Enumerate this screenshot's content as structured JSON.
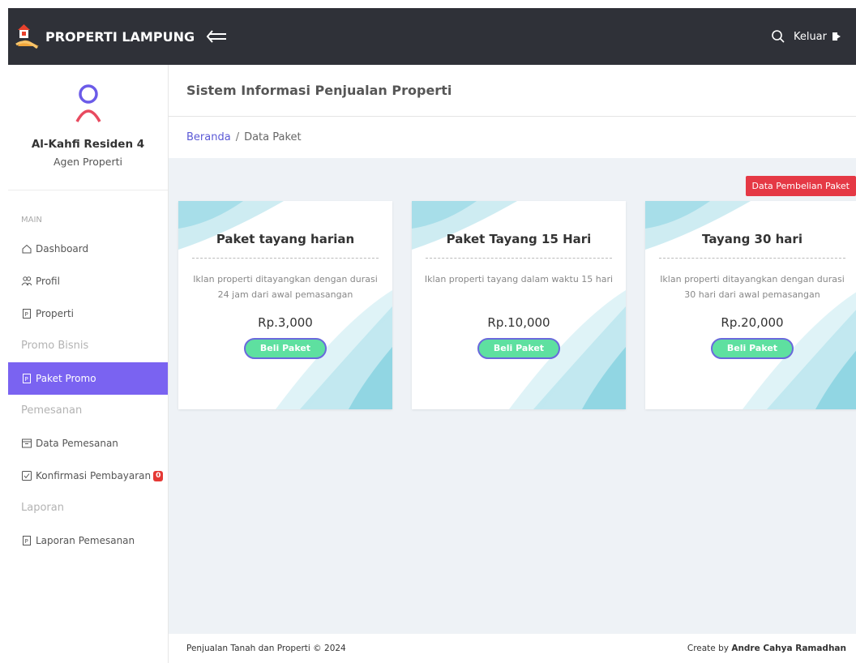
{
  "app": {
    "brand": "PROPERTI LAMPUNG",
    "logout_label": "Keluar"
  },
  "sidebar": {
    "profile_name": "Al-Kahfi Residen 4",
    "profile_role": "Agen Properti",
    "section_main": "MAIN",
    "items": [
      {
        "label": "Dashboard",
        "icon": "home-icon"
      },
      {
        "label": "Profil",
        "icon": "users-icon"
      },
      {
        "label": "Properti",
        "icon": "document-icon"
      }
    ],
    "header_promo": "Promo Bisnis",
    "promo_item": {
      "label": "Paket Promo",
      "icon": "document-icon"
    },
    "header_pemesanan": "Pemesanan",
    "pemesanan_items": [
      {
        "label": "Data Pemesanan",
        "icon": "inbox-icon"
      },
      {
        "label": "Konfirmasi Pembayaran",
        "icon": "check-square-icon",
        "badge": "0"
      }
    ],
    "header_laporan": "Laporan",
    "laporan_item": {
      "label": "Laporan Pemesanan",
      "icon": "document-icon"
    }
  },
  "main": {
    "page_title": "Sistem Informasi Penjualan Properti",
    "breadcrumb": {
      "home": "Beranda",
      "separator": "/",
      "current": "Data Paket"
    },
    "purchase_button": "Data Pembelian Paket",
    "cards": [
      {
        "title": "Paket tayang harian",
        "description": "Iklan properti ditayangkan dengan durasi 24 jam dari awal pemasangan",
        "price": "Rp.3,000",
        "button": "Beli Paket"
      },
      {
        "title": "Paket Tayang 15 Hari",
        "description": "Iklan properti tayang dalam waktu 15 hari",
        "price": "Rp.10,000",
        "button": "Beli Paket"
      },
      {
        "title": "Tayang 30 hari",
        "description": "Iklan properti ditayangkan dengan durasi 30 hari dari awal pemasangan",
        "price": "Rp.20,000",
        "button": "Beli Paket"
      }
    ]
  },
  "footer": {
    "left": "Penjualan Tanah dan Properti © 2024",
    "right_prefix": "Create by",
    "right_author": "Andre Cahya Ramadhan"
  },
  "colors": {
    "topbar": "#2f3138",
    "active_nav": "#7a63f1",
    "danger": "#e53945",
    "buy_button": "#5ee0a0"
  }
}
